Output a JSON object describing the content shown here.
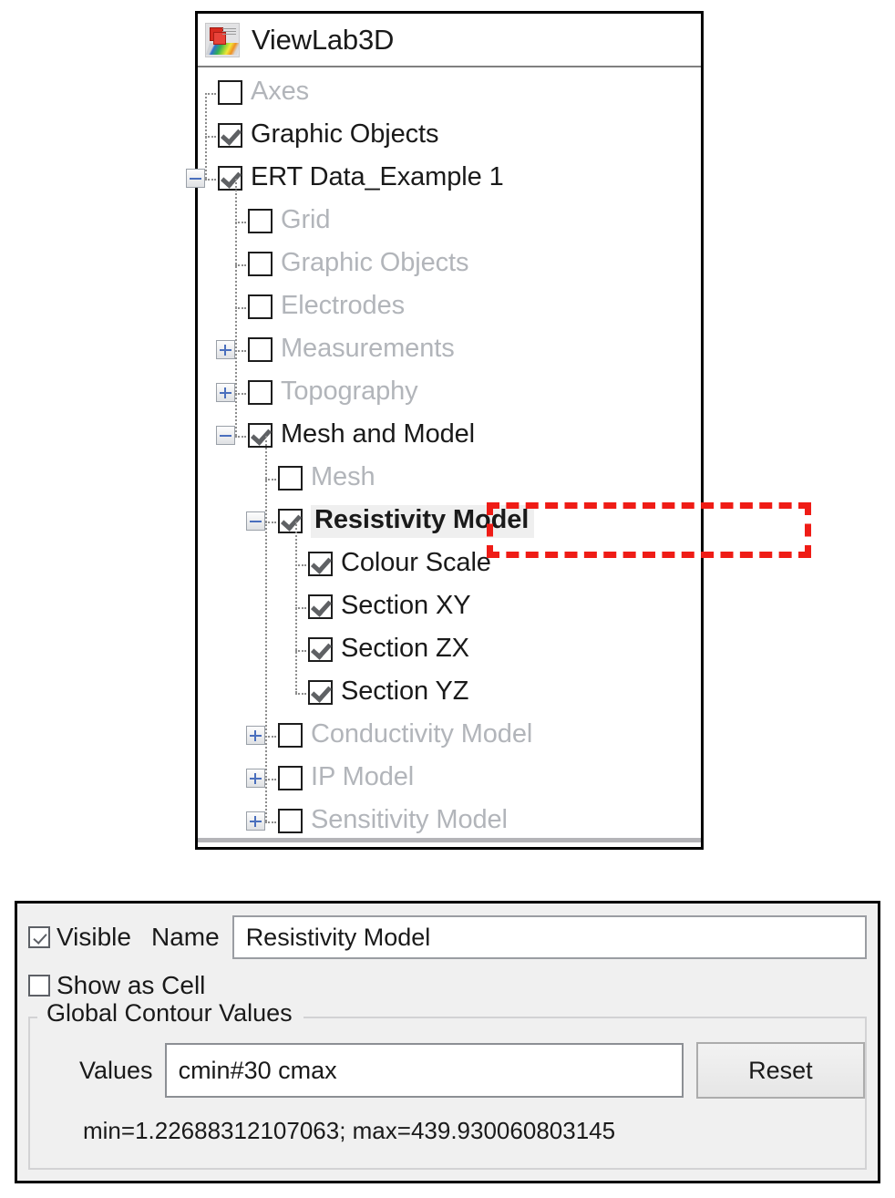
{
  "window": {
    "title": "ViewLab3D",
    "icon": "viewlab3d-app-icon"
  },
  "tree": {
    "items": [
      {
        "label": "Axes",
        "level": 0,
        "checked": false,
        "dim": true,
        "expander": "none",
        "selected": false
      },
      {
        "label": "Graphic Objects",
        "level": 0,
        "checked": true,
        "dim": false,
        "expander": "none",
        "selected": false
      },
      {
        "label": "ERT Data_Example 1",
        "level": 0,
        "checked": true,
        "dim": false,
        "expander": "collapse",
        "selected": false
      },
      {
        "label": "Grid",
        "level": 1,
        "checked": false,
        "dim": true,
        "expander": "none",
        "selected": false
      },
      {
        "label": "Graphic Objects",
        "level": 1,
        "checked": false,
        "dim": true,
        "expander": "none",
        "selected": false
      },
      {
        "label": "Electrodes",
        "level": 1,
        "checked": false,
        "dim": true,
        "expander": "none",
        "selected": false
      },
      {
        "label": "Measurements",
        "level": 1,
        "checked": false,
        "dim": true,
        "expander": "expand",
        "selected": false
      },
      {
        "label": "Topography",
        "level": 1,
        "checked": false,
        "dim": true,
        "expander": "expand",
        "selected": false
      },
      {
        "label": "Mesh and Model",
        "level": 1,
        "checked": true,
        "dim": false,
        "expander": "collapse",
        "selected": false
      },
      {
        "label": "Mesh",
        "level": 2,
        "checked": false,
        "dim": true,
        "expander": "none",
        "selected": false
      },
      {
        "label": "Resistivity Model",
        "level": 2,
        "checked": true,
        "dim": false,
        "expander": "collapse",
        "selected": true
      },
      {
        "label": "Colour Scale",
        "level": 3,
        "checked": true,
        "dim": false,
        "expander": "none",
        "selected": false
      },
      {
        "label": "Section XY",
        "level": 3,
        "checked": true,
        "dim": false,
        "expander": "none",
        "selected": false
      },
      {
        "label": "Section ZX",
        "level": 3,
        "checked": true,
        "dim": false,
        "expander": "none",
        "selected": false
      },
      {
        "label": "Section YZ",
        "level": 3,
        "checked": true,
        "dim": false,
        "expander": "none",
        "selected": false
      },
      {
        "label": "Conductivity Model",
        "level": 2,
        "checked": false,
        "dim": true,
        "expander": "expand",
        "selected": false
      },
      {
        "label": "IP Model",
        "level": 2,
        "checked": false,
        "dim": true,
        "expander": "expand",
        "selected": false
      },
      {
        "label": "Sensitivity Model",
        "level": 2,
        "checked": false,
        "dim": true,
        "expander": "expand",
        "selected": false
      }
    ]
  },
  "annotation": {
    "target": "Resistivity Model",
    "color": "#ef1c16",
    "style": "red-dashed-highlight"
  },
  "properties": {
    "visible_label": "Visible",
    "visible_checked": true,
    "name_label": "Name",
    "name_value": "Resistivity Model",
    "show_as_cell_label": "Show as Cell",
    "show_as_cell_checked": false,
    "group_title": "Global Contour Values",
    "values_label": "Values",
    "values_value": "cmin#30 cmax",
    "reset_label": "Reset",
    "minmax_text": "min=1.22688312107063; max=439.930060803145"
  }
}
